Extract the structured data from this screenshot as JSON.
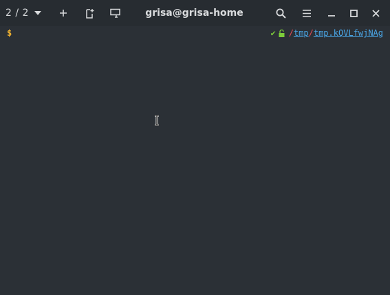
{
  "titlebar": {
    "tab_counter": "2 / 2",
    "title": "grisa@grisa-home",
    "icons": {
      "tab_menu": "chevron-down-icon",
      "new_tab": "plus-icon",
      "new_window": "document-new-icon",
      "split": "terminal-split-icon",
      "search": "search-icon",
      "menu": "hamburger-menu-icon",
      "minimize": "minimize-icon",
      "maximize": "maximize-icon",
      "close": "close-icon"
    }
  },
  "terminal": {
    "prompt_symbol": "$",
    "status_check": "✔",
    "path": {
      "sep1": "/",
      "seg1": "tmp",
      "sep2": "/",
      "seg2": "tmp.kQVLfwjNAg"
    }
  },
  "colors": {
    "background": "#2b3036",
    "titlebar": "#272c31",
    "prompt": "#f0b230",
    "check": "#7ccc3a",
    "path_separator": "#e84a55",
    "path_segment": "#4aa7e8"
  }
}
